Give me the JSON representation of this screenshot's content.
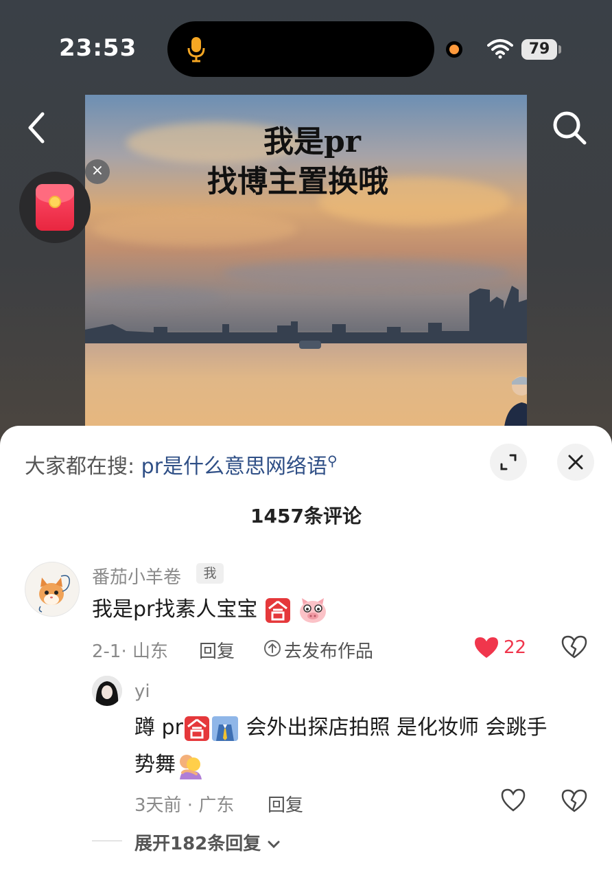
{
  "status_bar": {
    "time": "23:53",
    "battery": "79"
  },
  "post": {
    "caption_line1": "我是pr",
    "caption_line2": "找博主置换哦"
  },
  "sheet": {
    "hot_search_label": "大家都在搜:",
    "hot_search_term": "pr是什么意思网络语",
    "comment_count": "1457条评论"
  },
  "comments": [
    {
      "username": "番茄小羊卷",
      "badge": "我",
      "text": "我是pr找素人宝宝",
      "date_location": "2-1· 山东",
      "reply_label": "回复",
      "publish_label": "去发布作品",
      "likes": "22",
      "liked": true
    }
  ],
  "replies": [
    {
      "username": "yi",
      "text_line1a": "蹲 pr",
      "text_line1b": " 会外出探店拍照 是化妆师 会跳手",
      "text_line2": "势舞",
      "date_location": "3天前 · 广东",
      "reply_label": "回复"
    }
  ],
  "expand_replies": "展开182条回复",
  "colors": {
    "like": "#f0364c",
    "link": "#2f4f86",
    "sheet_bg": "#ffffff"
  },
  "icons": [
    "microphone-icon",
    "wifi-icon",
    "back-icon",
    "search-icon",
    "red-envelope-icon",
    "close-icon",
    "expand-icon",
    "heart-icon",
    "broken-heart-icon",
    "upload-icon",
    "chevron-down-icon"
  ]
}
